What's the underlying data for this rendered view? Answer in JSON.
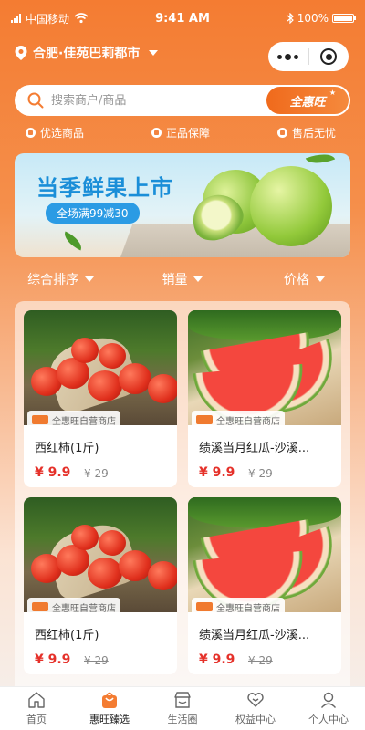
{
  "status_bar": {
    "carrier": "中国移动",
    "time": "9:41 AM",
    "battery": "100%"
  },
  "location": {
    "label": "合肥·佳苑巴莉都市"
  },
  "search": {
    "placeholder": "搜索商户/商品",
    "brand_button": "全惠旺"
  },
  "guarantees": [
    {
      "label": "优选商品",
      "icon": "diamond-icon"
    },
    {
      "label": "正品保障",
      "icon": "shield-icon"
    },
    {
      "label": "售后无忧",
      "icon": "service-icon"
    }
  ],
  "banner": {
    "title": "当季鲜果上市",
    "tag": "全场满99减30"
  },
  "sort": [
    {
      "label": "综合排序"
    },
    {
      "label": "销量"
    },
    {
      "label": "价格"
    }
  ],
  "products": [
    {
      "name": "西红柿(1斤)",
      "price": "¥ 9.9",
      "original_price": "¥ 29",
      "shop": "全惠旺自营商店",
      "image": "tomato"
    },
    {
      "name": "绩溪当月红瓜-沙溪...",
      "price": "¥ 9.9",
      "original_price": "¥ 29",
      "shop": "全惠旺自营商店",
      "image": "watermelon"
    },
    {
      "name": "西红柿(1斤)",
      "price": "¥ 9.9",
      "original_price": "¥ 29",
      "shop": "全惠旺自营商店",
      "image": "tomato"
    },
    {
      "name": "绩溪当月红瓜-沙溪...",
      "price": "¥ 9.9",
      "original_price": "¥ 29",
      "shop": "全惠旺自营商店",
      "image": "watermelon"
    }
  ],
  "tabs": [
    {
      "label": "首页",
      "icon": "home-icon"
    },
    {
      "label": "惠旺臻选",
      "icon": "shopping-bag-icon",
      "active": true
    },
    {
      "label": "生活圈",
      "icon": "store-icon"
    },
    {
      "label": "权益中心",
      "icon": "heart-icon"
    },
    {
      "label": "个人中心",
      "icon": "user-icon"
    }
  ],
  "colors": {
    "accent": "#f47c32",
    "price": "#e5312a",
    "banner_title": "#1a8ed8"
  }
}
